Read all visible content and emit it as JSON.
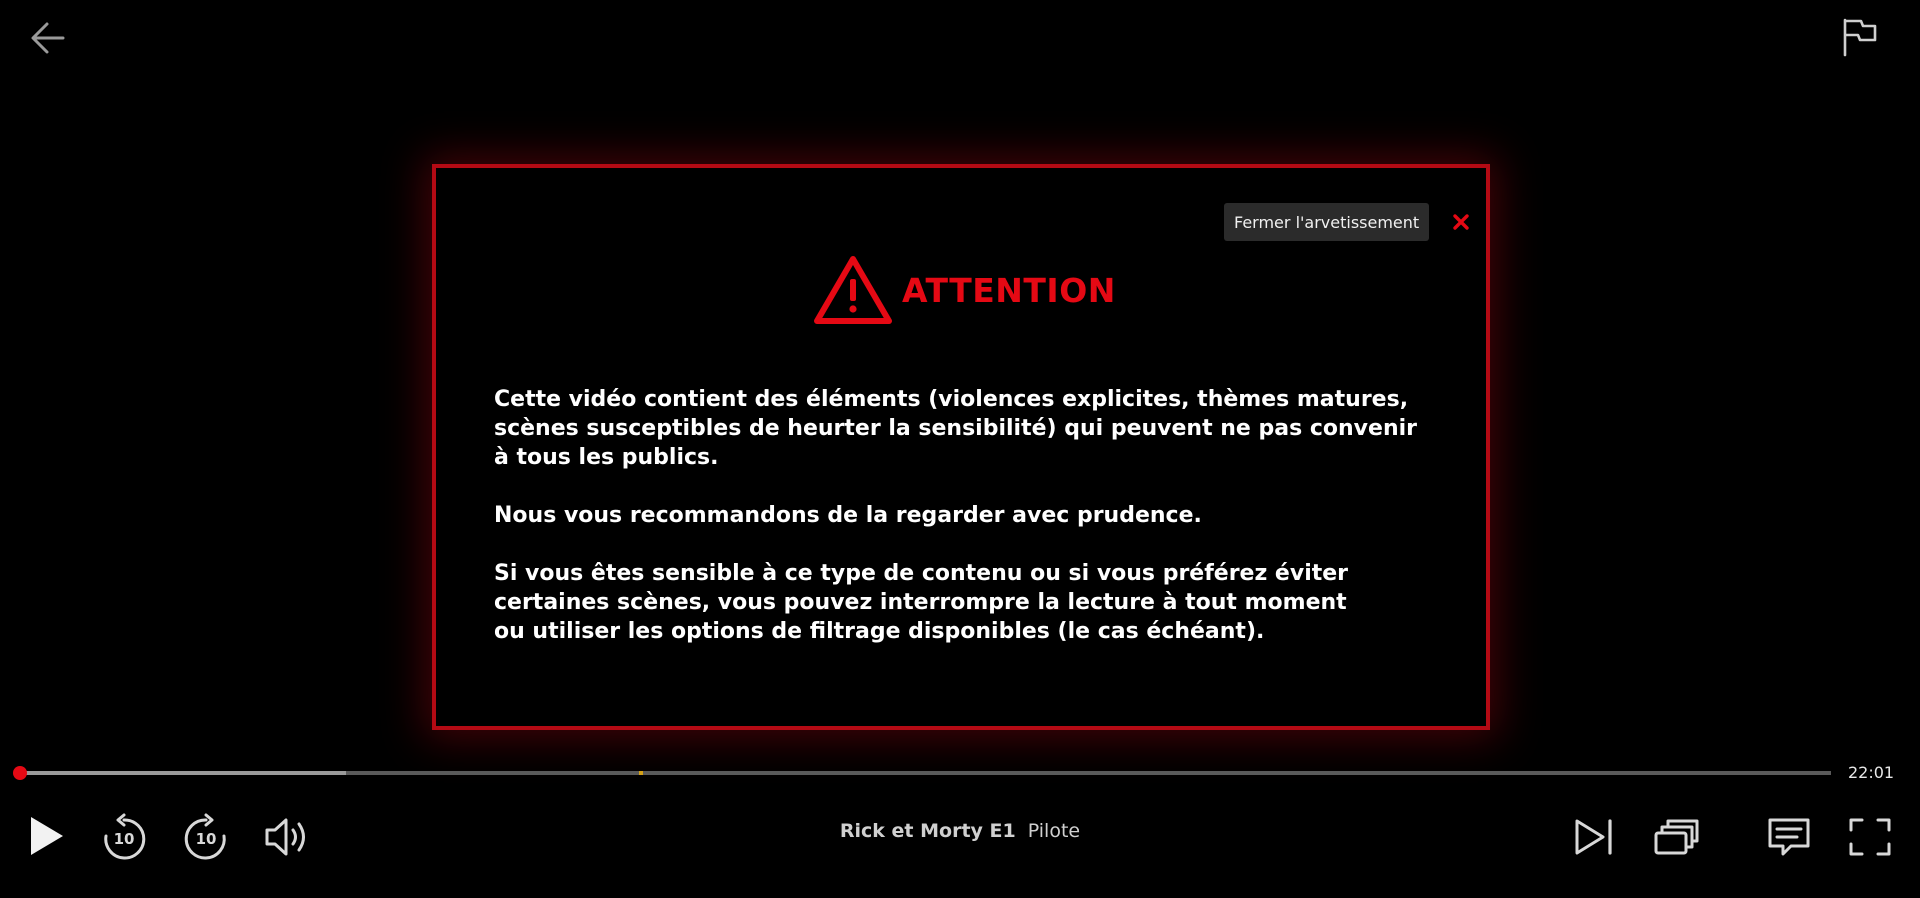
{
  "player": {
    "back_icon": "arrow-left-icon",
    "report_icon": "flag-icon"
  },
  "warning": {
    "close_label": "Fermer l'arvetissement",
    "close_icon": "close-x-icon",
    "title": "ATTENTION",
    "title_icon": "warning-triangle-icon",
    "paragraphs": [
      "Cette vidéo contient des éléments (violences explicites, thèmes matures,\nscènes susceptibles de heurter la sensibilité) qui peuvent ne pas convenir\nà tous les publics.",
      "Nous vous recommandons de la regarder avec prudence.",
      "Si vous êtes sensible à ce type de contenu ou si vous préférez éviter\ncertaines scènes, vous pouvez interrompre la lecture à tout moment\n ou utiliser les options de filtrage disponibles (le cas échéant)."
    ],
    "accent_color": "#e50914"
  },
  "progress": {
    "played_fraction": 0.0,
    "buffered_fraction": 0.18,
    "marker_fraction": 0.342,
    "time_remaining": "22:01"
  },
  "controls": {
    "play_icon": "play-icon",
    "rewind_icon": "rewind-10-icon",
    "rewind_label": "10",
    "forward_icon": "forward-10-icon",
    "forward_label": "10",
    "volume_icon": "volume-icon",
    "next_icon": "next-episode-icon",
    "episodes_icon": "episodes-icon",
    "subtitles_icon": "subtitles-icon",
    "fullscreen_icon": "fullscreen-icon"
  },
  "episode": {
    "show_title": "Rick et Morty E1",
    "episode_title": "Pilote"
  }
}
